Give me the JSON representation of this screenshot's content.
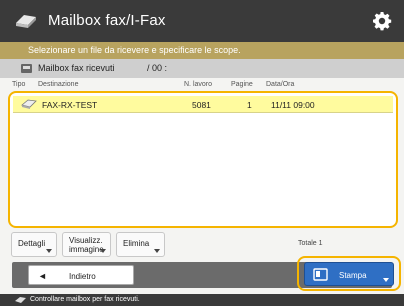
{
  "titlebar": {
    "title": "Mailbox fax/I-Fax",
    "title_icon": "fax-mailbox-icon",
    "settings_icon": "gear-icon"
  },
  "instruction": "Selezionare un file da ricevere e specificare le scope.",
  "mailbox": {
    "name": "Mailbox fax ricevuti",
    "count": "/ 00 :"
  },
  "columns": {
    "type": "Tipo",
    "destination": "Destinazione",
    "num": "N. lavoro",
    "pages": "Pagine",
    "datetime": "Data/Ora"
  },
  "rows": [
    {
      "name": "FAX-RX-TEST",
      "num": "5081",
      "pages": "1",
      "datetime": "11/11  09:00",
      "selected": true
    }
  ],
  "buttons": {
    "details": "Dettagli",
    "view_line1": "Visualizz.",
    "view_line2": "immagine",
    "delete": "Elimina",
    "back": "Indietro",
    "back_arrow": "◄",
    "print": "Stampa"
  },
  "totals": "Totale 1",
  "status_text": "Controllare mailbox per fax ricevuti.",
  "colors": {
    "accent": "#f5b400",
    "title_bg": "#3a3a3a",
    "instr_bg": "#b8a35f",
    "print_bg": "#2f6fc4",
    "selected_row": "#fffb9e"
  }
}
